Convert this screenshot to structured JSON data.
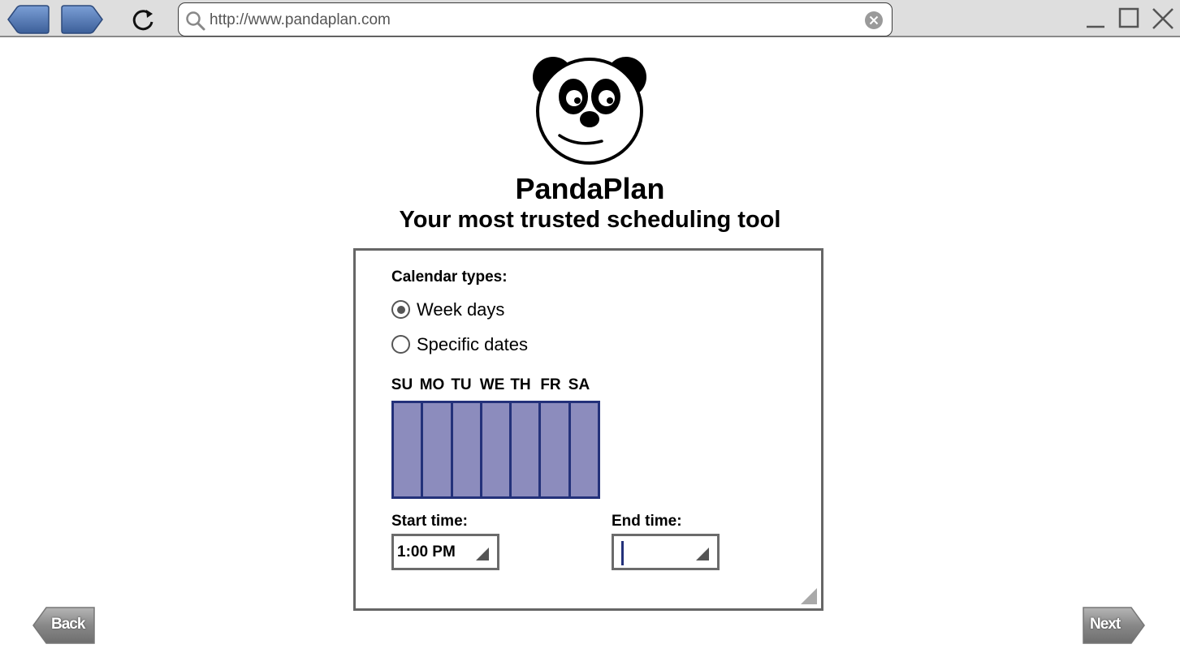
{
  "browser": {
    "url": "http://www.pandaplan.com",
    "accent": "#4f74b0"
  },
  "header": {
    "title": "PandaPlan",
    "tagline": "Your most trusted scheduling tool"
  },
  "form": {
    "calendar_types_label": "Calendar types:",
    "calendar_types": [
      {
        "label": "Week days",
        "selected": true
      },
      {
        "label": "Specific dates",
        "selected": false
      }
    ],
    "days": [
      "SU",
      "MO",
      "TU",
      "WE",
      "TH",
      "FR",
      "SA"
    ],
    "day_grid_fill": "#8c8cbd",
    "day_grid_border": "#23317a",
    "start_time_label": "Start time:",
    "start_time_value": "1:00 PM",
    "end_time_label": "End time:",
    "end_time_value": ""
  },
  "nav": {
    "back_label": "Back",
    "next_label": "Next"
  }
}
